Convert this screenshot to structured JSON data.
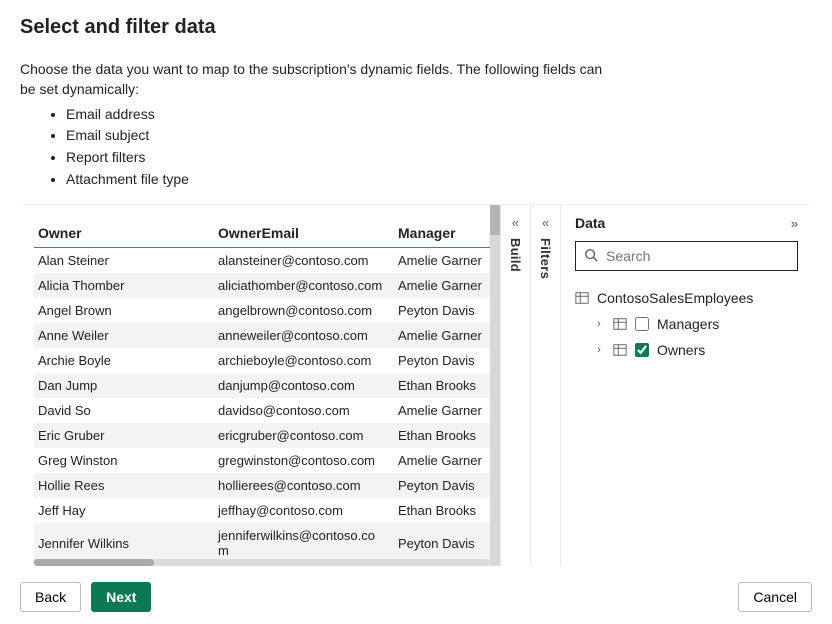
{
  "header": {
    "title": "Select and filter data",
    "intro": "Choose the data you want to map to the subscription's dynamic fields. The following fields can be set dynamically:",
    "bullets": [
      "Email address",
      "Email subject",
      "Report filters",
      "Attachment file type"
    ]
  },
  "grid": {
    "columns": [
      "Owner",
      "OwnerEmail",
      "Manager"
    ],
    "rows": [
      {
        "owner": "Alan Steiner",
        "email": "alansteiner@contoso.com",
        "manager": "Amelie Garner"
      },
      {
        "owner": "Alicia Thomber",
        "email": "aliciathomber@contoso.com",
        "manager": "Amelie Garner"
      },
      {
        "owner": "Angel Brown",
        "email": "angelbrown@contoso.com",
        "manager": "Peyton Davis"
      },
      {
        "owner": "Anne Weiler",
        "email": "anneweiler@contoso.com",
        "manager": "Amelie Garner"
      },
      {
        "owner": "Archie Boyle",
        "email": "archieboyle@contoso.com",
        "manager": "Peyton Davis"
      },
      {
        "owner": "Dan Jump",
        "email": "danjump@contoso.com",
        "manager": "Ethan Brooks"
      },
      {
        "owner": "David So",
        "email": "davidso@contoso.com",
        "manager": "Amelie Garner"
      },
      {
        "owner": "Eric Gruber",
        "email": "ericgruber@contoso.com",
        "manager": "Ethan Brooks"
      },
      {
        "owner": "Greg Winston",
        "email": "gregwinston@contoso.com",
        "manager": "Amelie Garner"
      },
      {
        "owner": "Hollie Rees",
        "email": "hollierees@contoso.com",
        "manager": "Peyton Davis"
      },
      {
        "owner": "Jeff Hay",
        "email": "jeffhay@contoso.com",
        "manager": "Ethan Brooks"
      },
      {
        "owner": "Jennifer Wilkins",
        "email": "jenniferwilkins@contoso.com",
        "manager": "Peyton Davis"
      }
    ]
  },
  "rails": {
    "build": "Build",
    "filters": "Filters"
  },
  "dataPanel": {
    "title": "Data",
    "searchPlaceholder": "Search",
    "dataset": "ContosoSalesEmployees",
    "tables": [
      {
        "name": "Managers",
        "checked": false
      },
      {
        "name": "Owners",
        "checked": true
      }
    ]
  },
  "footer": {
    "back": "Back",
    "next": "Next",
    "cancel": "Cancel"
  }
}
